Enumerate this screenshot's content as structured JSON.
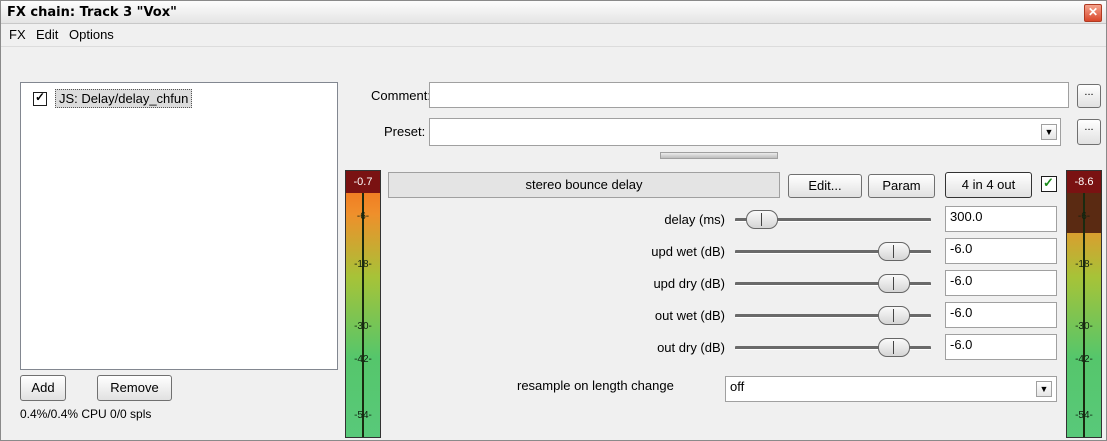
{
  "window": {
    "title": "FX chain: Track 3 \"Vox\"",
    "close_symbol": "✕"
  },
  "menu": [
    "FX",
    "Edit",
    "Options"
  ],
  "fx_list": {
    "items": [
      {
        "name": "JS: Delay/delay_chfun",
        "enabled": true
      }
    ]
  },
  "buttons": {
    "add": "Add",
    "remove": "Remove",
    "comment_more": "...",
    "preset_more": "...",
    "edit": "Edit...",
    "param": "Param",
    "io": "4 in 4 out"
  },
  "status": {
    "cpu": "0.4%/0.4% CPU 0/0 spls"
  },
  "comment": {
    "label": "Comment:",
    "value": ""
  },
  "preset": {
    "label": "Preset:",
    "value": ""
  },
  "plugin": {
    "name": "stereo bounce delay",
    "enabled": true
  },
  "meters": {
    "left_peak": "-0.7",
    "right_peak": "-8.6",
    "ticks": [
      "-6-",
      "-18-",
      "-30-",
      "-42-",
      "-54-"
    ]
  },
  "params": [
    {
      "label": "delay (ms)",
      "value": "300.0",
      "level": 0.07
    },
    {
      "label": "upd wet (dB)",
      "value": "-6.0",
      "level": 0.87
    },
    {
      "label": "upd dry (dB)",
      "value": "-6.0",
      "level": 0.87
    },
    {
      "label": "out wet (dB)",
      "value": "-6.0",
      "level": 0.87
    },
    {
      "label": "out dry (dB)",
      "value": "-6.0",
      "level": 0.87
    }
  ],
  "resample": {
    "label": "resample on length change",
    "value": "off"
  },
  "icons": {
    "dropdown": "chevron-down-icon",
    "check": "checkmark-icon"
  }
}
